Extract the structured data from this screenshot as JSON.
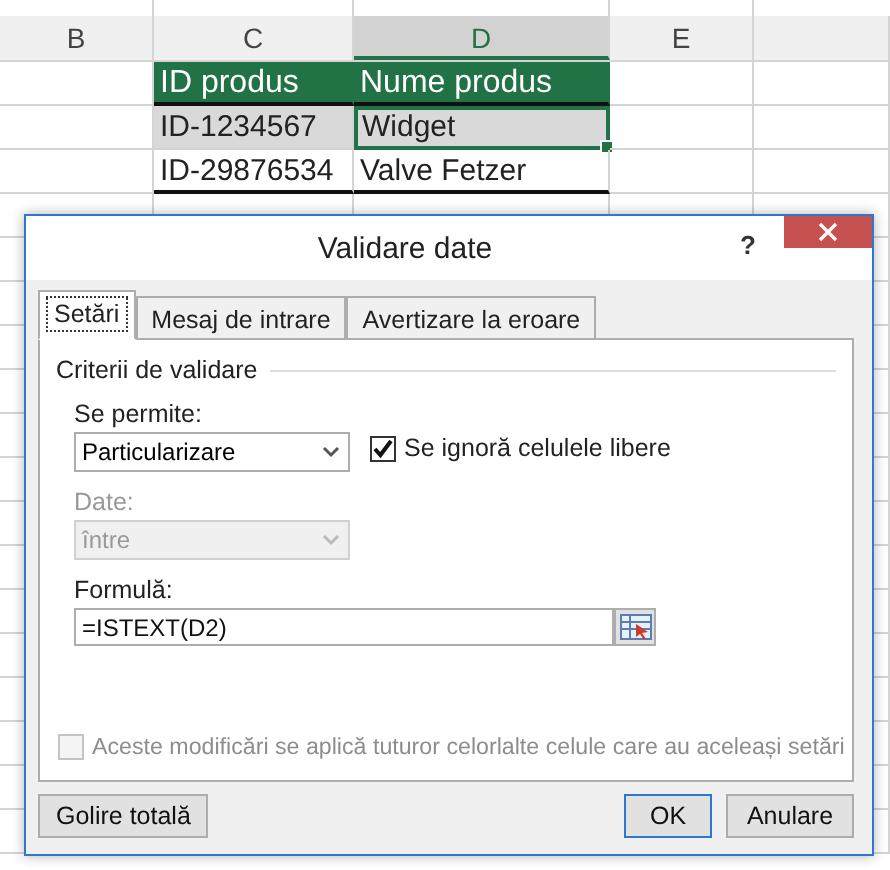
{
  "sheet": {
    "columns": [
      {
        "label": "B",
        "selected": false
      },
      {
        "label": "C",
        "selected": false
      },
      {
        "label": "D",
        "selected": true
      },
      {
        "label": "E",
        "selected": false
      }
    ],
    "table": {
      "header": [
        "ID produs",
        "Nume produs"
      ],
      "rows": [
        {
          "shaded": true,
          "cells": [
            {
              "text": "ID-1234567",
              "selected": false
            },
            {
              "text": "Widget",
              "selected": true
            }
          ]
        },
        {
          "shaded": false,
          "cells": [
            {
              "text": "ID-29876534",
              "selected": false
            },
            {
              "text": "Valve Fetzer",
              "selected": false
            }
          ]
        }
      ]
    }
  },
  "dialog": {
    "title": "Validare date",
    "help": "?",
    "tabs": [
      {
        "label": "Setări",
        "selected": true
      },
      {
        "label": "Mesaj de intrare",
        "selected": false
      },
      {
        "label": "Avertizare la eroare",
        "selected": false
      }
    ],
    "section_title": "Criterii de validare",
    "allow": {
      "label": "Se permite:",
      "value": "Particularizare",
      "disabled": false
    },
    "ignore_blank": {
      "label": "Se ignoră celulele libere",
      "checked": true
    },
    "data": {
      "label": "Date:",
      "value": "între",
      "disabled": true
    },
    "formula": {
      "label": "Formulă:",
      "value": "=ISTEXT(D2)"
    },
    "apply_all": {
      "label": "Aceste modificări se aplică tuturor celorlalte celule care au aceleași setări",
      "checked": false,
      "disabled": true
    },
    "buttons": [
      {
        "label": "Golire totală",
        "default": false
      },
      {
        "label": "OK",
        "default": true
      },
      {
        "label": "Anulare",
        "default": false
      }
    ]
  }
}
